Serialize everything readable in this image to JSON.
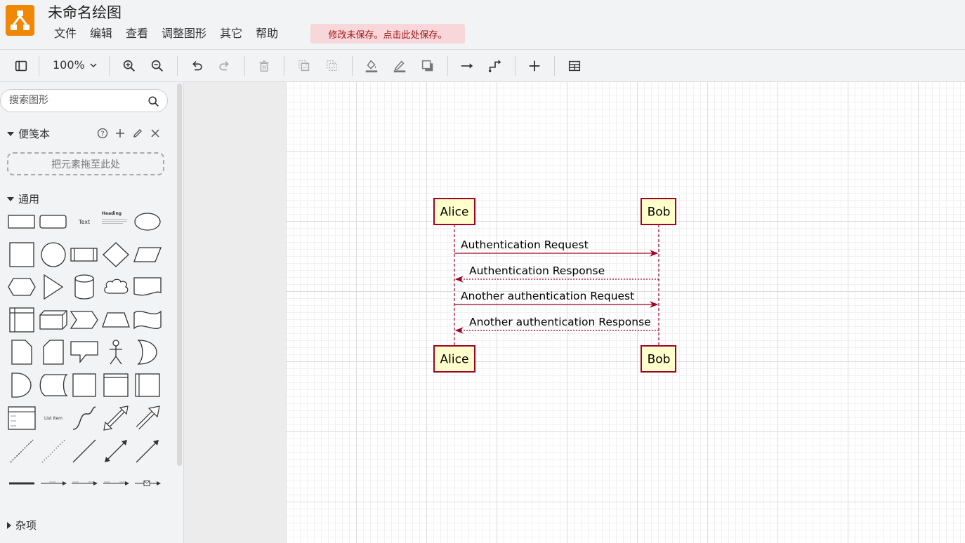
{
  "app": {
    "title": "未命名绘图",
    "save_warning": "修改未保存。点击此处保存。"
  },
  "menu": [
    {
      "label": "文件"
    },
    {
      "label": "编辑"
    },
    {
      "label": "查看"
    },
    {
      "label": "调整图形"
    },
    {
      "label": "其它"
    },
    {
      "label": "帮助"
    }
  ],
  "toolbar": {
    "zoom": "100%",
    "icons": [
      "format-panel-icon",
      "zoom-in-icon",
      "zoom-out-icon",
      "undo-icon",
      "redo-icon",
      "delete-icon",
      "to-front-icon",
      "to-back-icon",
      "fill-color-icon",
      "line-color-icon",
      "shadow-icon",
      "connection-icon",
      "waypoints-icon",
      "insert-icon",
      "table-icon"
    ]
  },
  "sidebar": {
    "search_placeholder": "搜索图形",
    "scratchpad": {
      "label": "便笺本",
      "dropzone": "把元素拖至此处"
    },
    "general": {
      "label": "通用"
    },
    "misc": {
      "label": "杂项"
    },
    "shape_texts": {
      "text": "Text",
      "heading": "Heading",
      "list_item": "List Item"
    }
  },
  "diagram": {
    "accent": "#a20025",
    "participant_fill": "#ffffcc",
    "participants_top": [
      {
        "label": "Alice"
      },
      {
        "label": "Bob"
      }
    ],
    "participants_bottom": [
      {
        "label": "Alice"
      },
      {
        "label": "Bob"
      }
    ],
    "messages": [
      {
        "label": "Authentication Request",
        "direction": "right",
        "style": "solid"
      },
      {
        "label": "Authentication Response",
        "direction": "left",
        "style": "dashed"
      },
      {
        "label": "Another authentication Request",
        "direction": "right",
        "style": "solid"
      },
      {
        "label": "Another authentication Response",
        "direction": "left",
        "style": "dashed"
      }
    ]
  }
}
